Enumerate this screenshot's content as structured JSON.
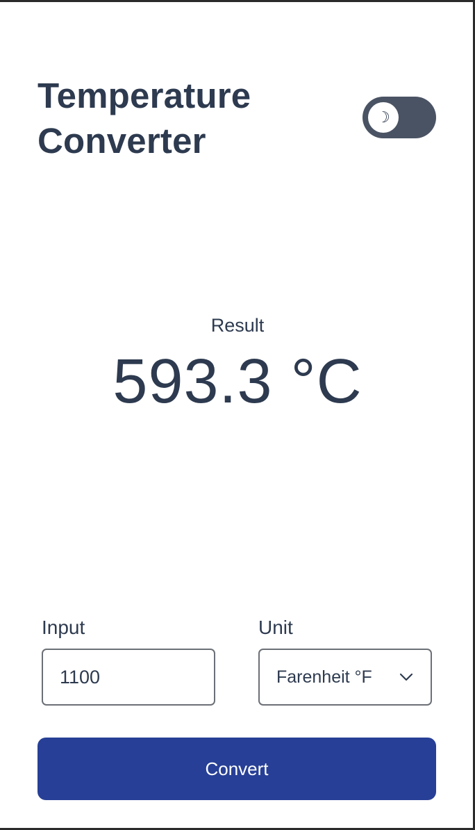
{
  "header": {
    "title_line1": "Temperature",
    "title_line2": "Converter",
    "theme_toggle_icon": "moon-icon",
    "theme_toggle_glyph": "☽"
  },
  "result": {
    "label": "Result",
    "value": "593.3 °C"
  },
  "form": {
    "input_label": "Input",
    "input_value": "1100",
    "unit_label": "Unit",
    "unit_selected": "Farenheit °F",
    "convert_label": "Convert"
  },
  "colors": {
    "text": "#2d3a4f",
    "toggle_track": "#4a5363",
    "button": "#273f96",
    "border": "#6b6f76"
  }
}
